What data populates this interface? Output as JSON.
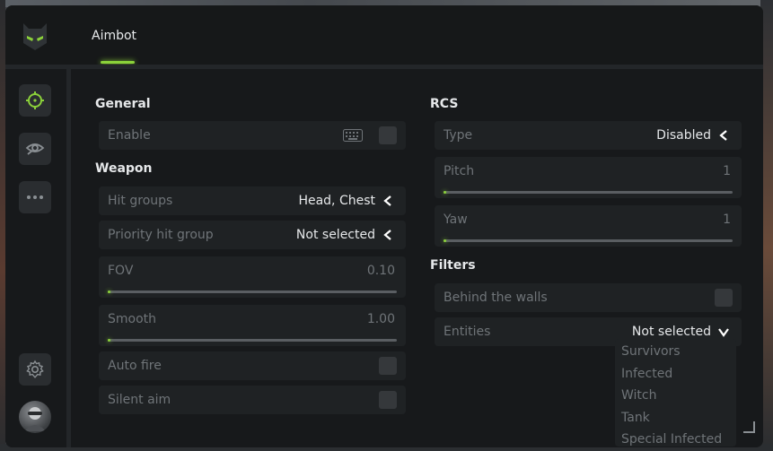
{
  "header": {
    "tab_label": "Aimbot"
  },
  "colors": {
    "accent": "#8bd13a",
    "panel": "#17191b",
    "row": "#1f2224",
    "muted": "#6f7478"
  },
  "sidebar": {
    "items": [
      {
        "icon": "crosshair-icon",
        "active": true
      },
      {
        "icon": "eye-icon",
        "active": false
      },
      {
        "icon": "more-icon",
        "active": false
      }
    ],
    "settings_icon": "gear-icon",
    "avatar_icon": "avatar"
  },
  "general": {
    "title": "General",
    "enable": {
      "label": "Enable",
      "checked": false
    }
  },
  "weapon": {
    "title": "Weapon",
    "hit_groups": {
      "label": "Hit groups",
      "value": "Head, Chest"
    },
    "priority": {
      "label": "Priority hit group",
      "value": "Not selected"
    },
    "fov": {
      "label": "FOV",
      "value": "0.10",
      "fraction": 0.0
    },
    "smooth": {
      "label": "Smooth",
      "value": "1.00",
      "fraction": 0.0
    },
    "auto_fire": {
      "label": "Auto fire",
      "checked": false
    },
    "silent_aim": {
      "label": "Silent aim",
      "checked": false
    }
  },
  "rcs": {
    "title": "RCS",
    "type": {
      "label": "Type",
      "value": "Disabled"
    },
    "pitch": {
      "label": "Pitch",
      "value": "1",
      "fraction": 0.0
    },
    "yaw": {
      "label": "Yaw",
      "value": "1",
      "fraction": 0.0
    }
  },
  "filters": {
    "title": "Filters",
    "behind_walls": {
      "label": "Behind the walls",
      "checked": false
    },
    "entities": {
      "label": "Entities",
      "value": "Not selected",
      "options": [
        "Survivors",
        "Infected",
        "Witch",
        "Tank",
        "Special Infected"
      ]
    }
  }
}
